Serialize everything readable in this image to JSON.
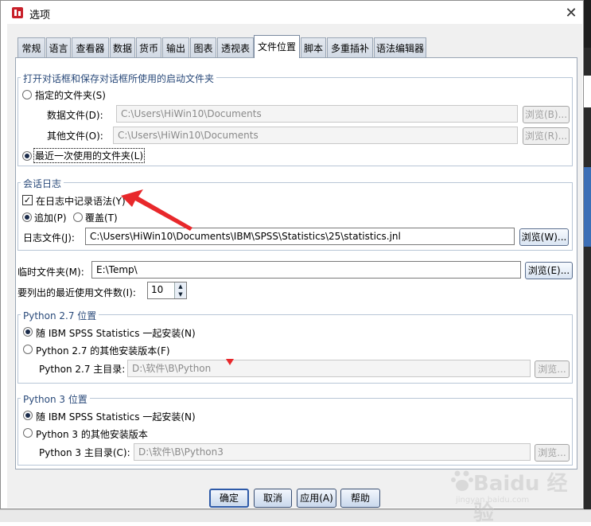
{
  "window": {
    "title": "选项",
    "close_glyph": "✕"
  },
  "tabs": [
    {
      "label": "常规"
    },
    {
      "label": "语言"
    },
    {
      "label": "查看器"
    },
    {
      "label": "数据"
    },
    {
      "label": "货币"
    },
    {
      "label": "输出"
    },
    {
      "label": "图表"
    },
    {
      "label": "透视表"
    },
    {
      "label": "文件位置",
      "active": true
    },
    {
      "label": "脚本"
    },
    {
      "label": "多重插补"
    },
    {
      "label": "语法编辑器"
    }
  ],
  "startup": {
    "title": "打开对话框和保存对话框所使用的启动文件夹",
    "specified_folder": "指定的文件夹(S)",
    "data_label": "数据文件(D):",
    "data_path": "C:\\Users\\HiWin10\\Documents",
    "data_browse": "浏览(B)...",
    "other_label": "其他文件(O):",
    "other_path": "C:\\Users\\HiWin10\\Documents",
    "other_browse": "浏览(R)...",
    "last_used": "最近一次使用的文件夹(L)"
  },
  "session": {
    "title": "会话日志",
    "record_syntax": "在日志中记录语法(Y)",
    "append": "追加(P)",
    "overwrite": "覆盖(T)",
    "log_label": "日志文件(J):",
    "log_path": "C:\\Users\\HiWin10\\Documents\\IBM\\SPSS\\Statistics\\25\\statistics.jnl",
    "log_browse": "浏览(W)..."
  },
  "temp": {
    "label": "临时文件夹(M):",
    "path": "E:\\Temp\\",
    "browse": "浏览(E)..."
  },
  "recent": {
    "label": "要列出的最近使用文件数(I):",
    "value": "10"
  },
  "python27": {
    "title": "Python 2.7 位置",
    "bundled": "随 IBM SPSS Statistics 一起安装(N)",
    "other": "Python 2.7 的其他安装版本(F)",
    "home_label": "Python 2.7 主目录:",
    "home_path": "D:\\软件\\B\\Python",
    "browse": "浏览..."
  },
  "python3": {
    "title": "Python 3 位置",
    "bundled": "随 IBM SPSS Statistics 一起安装(N)",
    "other": "Python 3 的其他安装版本",
    "home_label": "Python 3 主目录(C):",
    "home_path": "D:\\软件\\B\\Python3",
    "browse": "浏览..."
  },
  "buttons": {
    "ok": "确定",
    "cancel": "取消",
    "apply": "应用(A)",
    "help": "帮助"
  },
  "watermark": {
    "brand": "Baidu 经验",
    "url": "jingyan.baidu.com"
  },
  "colors": {
    "accent": "#2e5aa8",
    "annotation_red": "#e8282b"
  }
}
